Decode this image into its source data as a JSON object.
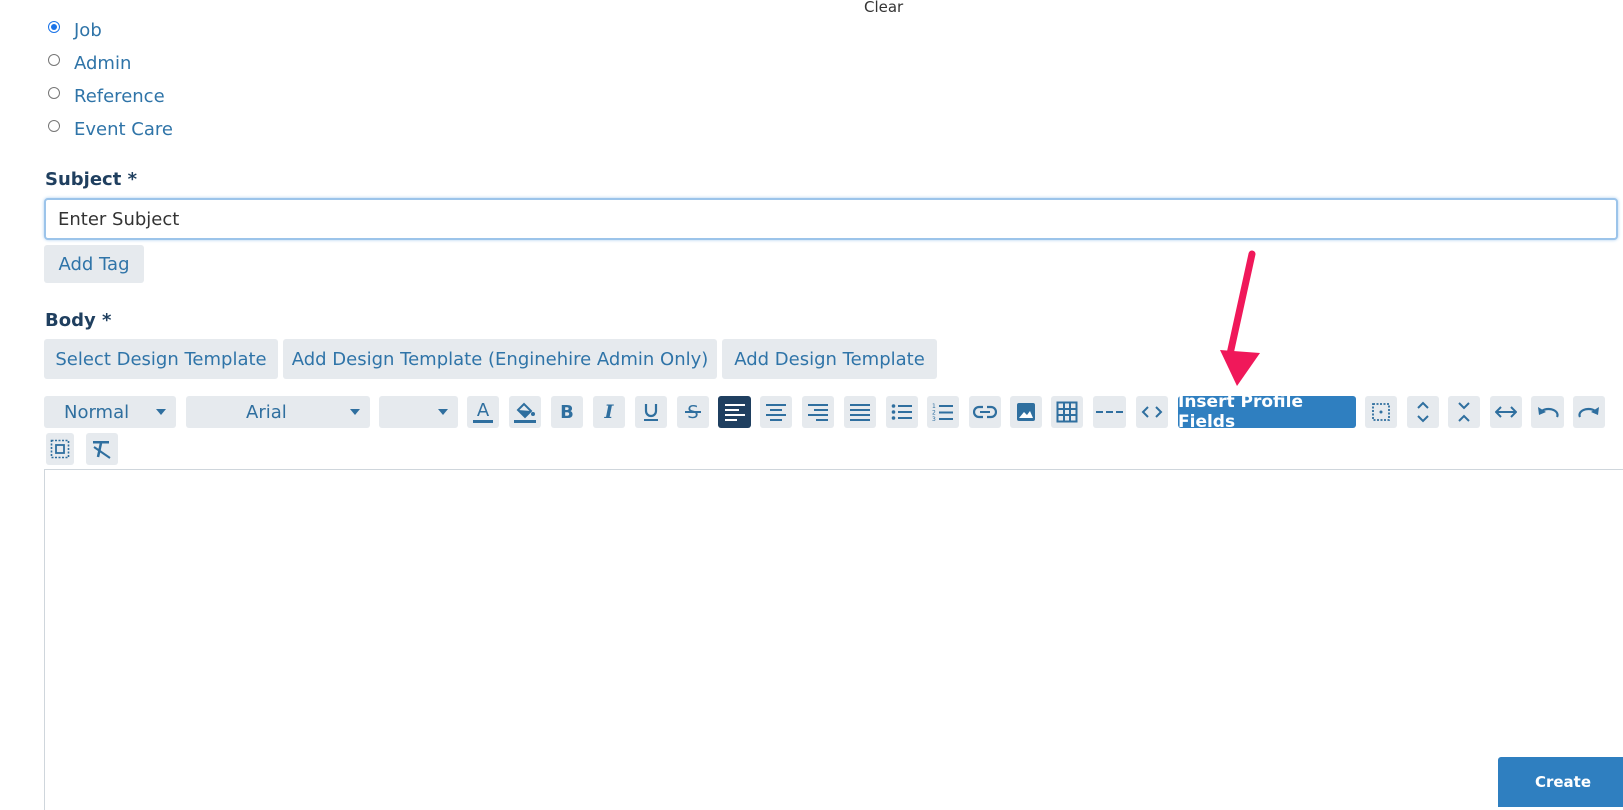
{
  "header": {
    "clear_label": "Clear"
  },
  "category_options": [
    {
      "label": "Job",
      "checked": true
    },
    {
      "label": "Admin",
      "checked": false
    },
    {
      "label": "Reference",
      "checked": false
    },
    {
      "label": "Event Care",
      "checked": false
    }
  ],
  "subject": {
    "label": "Subject *",
    "value": "Enter Subject",
    "add_tag_label": "Add Tag"
  },
  "body": {
    "label": "Body *",
    "template_buttons": [
      "Select Design Template",
      "Add Design Template (Enginehire Admin Only)",
      "Add Design Template"
    ]
  },
  "toolbar": {
    "paragraph_style": "Normal",
    "font_family": "Arial",
    "font_size": "",
    "insert_profile_fields_label": "Insert Profile Fields",
    "icons": [
      "text-color-icon",
      "highlight-color-icon",
      "bold-icon",
      "italic-icon",
      "underline-icon",
      "strikethrough-icon",
      "align-left-icon",
      "align-center-icon",
      "align-right-icon",
      "align-justify-icon",
      "bullet-list-icon",
      "numbered-list-icon",
      "link-icon",
      "image-icon",
      "table-icon",
      "horizontal-rule-icon",
      "code-view-icon",
      "insert-profile-fields",
      "select-all-icon",
      "expand-vertical-icon",
      "collapse-vertical-icon",
      "expand-horizontal-icon",
      "undo-icon",
      "redo-icon",
      "fullscreen-icon",
      "clear-formatting-icon"
    ],
    "accent_color": "#2f7fc0",
    "active_color": "#1f3f60"
  },
  "annotation": {
    "arrow_color": "#f0185a"
  },
  "actions": {
    "create_label": "Create"
  }
}
